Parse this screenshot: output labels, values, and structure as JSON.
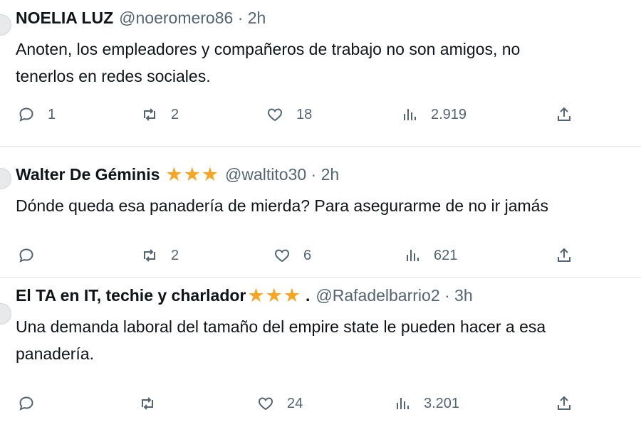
{
  "tweets": [
    {
      "name": "NOELIA LUZ",
      "stars": "",
      "handle": "@noeromero86 · 2h",
      "text_lines": [
        "Anoten, los empleadores y compañeros de trabajo no son amigos, no",
        "tenerlos en redes sociales."
      ],
      "replies": "1",
      "retweets": "2",
      "likes": "18",
      "views": "2.919"
    },
    {
      "name": "Walter De Géminis",
      "stars": "★★★",
      "handle": "@waltito30 · 2h",
      "text_lines": [
        "Dónde queda esa panadería de mierda? Para asegurarme de no ir jamás"
      ],
      "replies": "",
      "retweets": "2",
      "likes": "6",
      "views": "621"
    },
    {
      "name": "El TA en IT, techie y charlador",
      "stars": "★★★",
      "dot": ".",
      "handle": "@Rafadelbarrio2 · 3h",
      "text_lines": [
        "Una demanda laboral del tamaño del empire state le pueden hacer a esa",
        "panadería."
      ],
      "replies": "",
      "retweets": "",
      "likes": "24",
      "views": "3.201"
    }
  ],
  "icons": {
    "reply": "reply-icon",
    "retweet": "retweet-icon",
    "like": "heart-icon",
    "views": "views-icon",
    "share": "share-icon"
  },
  "colors": {
    "star": "#f6a623",
    "muted": "#536471",
    "divider": "#e1e8ed"
  }
}
